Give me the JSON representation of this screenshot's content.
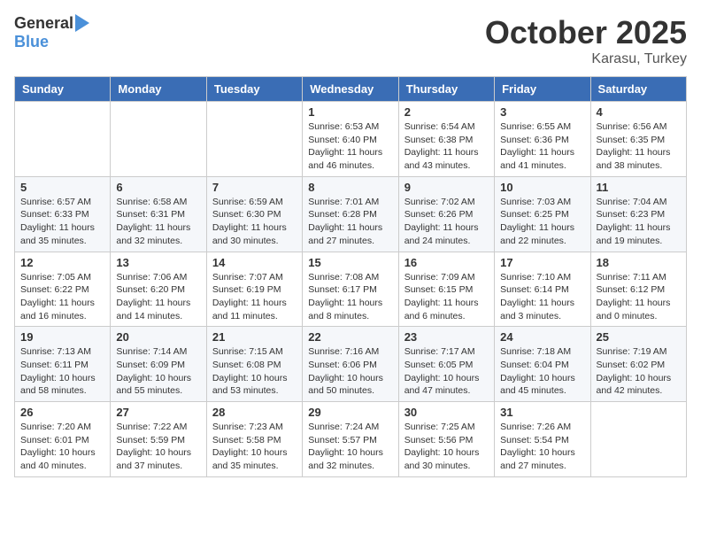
{
  "header": {
    "logo": {
      "general": "General",
      "blue": "Blue"
    },
    "title": "October 2025",
    "subtitle": "Karasu, Turkey"
  },
  "weekdays": [
    "Sunday",
    "Monday",
    "Tuesday",
    "Wednesday",
    "Thursday",
    "Friday",
    "Saturday"
  ],
  "weeks": [
    [
      null,
      null,
      null,
      {
        "day": "1",
        "sunrise": "6:53 AM",
        "sunset": "6:40 PM",
        "daylight": "11 hours and 46 minutes."
      },
      {
        "day": "2",
        "sunrise": "6:54 AM",
        "sunset": "6:38 PM",
        "daylight": "11 hours and 43 minutes."
      },
      {
        "day": "3",
        "sunrise": "6:55 AM",
        "sunset": "6:36 PM",
        "daylight": "11 hours and 41 minutes."
      },
      {
        "day": "4",
        "sunrise": "6:56 AM",
        "sunset": "6:35 PM",
        "daylight": "11 hours and 38 minutes."
      }
    ],
    [
      {
        "day": "5",
        "sunrise": "6:57 AM",
        "sunset": "6:33 PM",
        "daylight": "11 hours and 35 minutes."
      },
      {
        "day": "6",
        "sunrise": "6:58 AM",
        "sunset": "6:31 PM",
        "daylight": "11 hours and 32 minutes."
      },
      {
        "day": "7",
        "sunrise": "6:59 AM",
        "sunset": "6:30 PM",
        "daylight": "11 hours and 30 minutes."
      },
      {
        "day": "8",
        "sunrise": "7:01 AM",
        "sunset": "6:28 PM",
        "daylight": "11 hours and 27 minutes."
      },
      {
        "day": "9",
        "sunrise": "7:02 AM",
        "sunset": "6:26 PM",
        "daylight": "11 hours and 24 minutes."
      },
      {
        "day": "10",
        "sunrise": "7:03 AM",
        "sunset": "6:25 PM",
        "daylight": "11 hours and 22 minutes."
      },
      {
        "day": "11",
        "sunrise": "7:04 AM",
        "sunset": "6:23 PM",
        "daylight": "11 hours and 19 minutes."
      }
    ],
    [
      {
        "day": "12",
        "sunrise": "7:05 AM",
        "sunset": "6:22 PM",
        "daylight": "11 hours and 16 minutes."
      },
      {
        "day": "13",
        "sunrise": "7:06 AM",
        "sunset": "6:20 PM",
        "daylight": "11 hours and 14 minutes."
      },
      {
        "day": "14",
        "sunrise": "7:07 AM",
        "sunset": "6:19 PM",
        "daylight": "11 hours and 11 minutes."
      },
      {
        "day": "15",
        "sunrise": "7:08 AM",
        "sunset": "6:17 PM",
        "daylight": "11 hours and 8 minutes."
      },
      {
        "day": "16",
        "sunrise": "7:09 AM",
        "sunset": "6:15 PM",
        "daylight": "11 hours and 6 minutes."
      },
      {
        "day": "17",
        "sunrise": "7:10 AM",
        "sunset": "6:14 PM",
        "daylight": "11 hours and 3 minutes."
      },
      {
        "day": "18",
        "sunrise": "7:11 AM",
        "sunset": "6:12 PM",
        "daylight": "11 hours and 0 minutes."
      }
    ],
    [
      {
        "day": "19",
        "sunrise": "7:13 AM",
        "sunset": "6:11 PM",
        "daylight": "10 hours and 58 minutes."
      },
      {
        "day": "20",
        "sunrise": "7:14 AM",
        "sunset": "6:09 PM",
        "daylight": "10 hours and 55 minutes."
      },
      {
        "day": "21",
        "sunrise": "7:15 AM",
        "sunset": "6:08 PM",
        "daylight": "10 hours and 53 minutes."
      },
      {
        "day": "22",
        "sunrise": "7:16 AM",
        "sunset": "6:06 PM",
        "daylight": "10 hours and 50 minutes."
      },
      {
        "day": "23",
        "sunrise": "7:17 AM",
        "sunset": "6:05 PM",
        "daylight": "10 hours and 47 minutes."
      },
      {
        "day": "24",
        "sunrise": "7:18 AM",
        "sunset": "6:04 PM",
        "daylight": "10 hours and 45 minutes."
      },
      {
        "day": "25",
        "sunrise": "7:19 AM",
        "sunset": "6:02 PM",
        "daylight": "10 hours and 42 minutes."
      }
    ],
    [
      {
        "day": "26",
        "sunrise": "7:20 AM",
        "sunset": "6:01 PM",
        "daylight": "10 hours and 40 minutes."
      },
      {
        "day": "27",
        "sunrise": "7:22 AM",
        "sunset": "5:59 PM",
        "daylight": "10 hours and 37 minutes."
      },
      {
        "day": "28",
        "sunrise": "7:23 AM",
        "sunset": "5:58 PM",
        "daylight": "10 hours and 35 minutes."
      },
      {
        "day": "29",
        "sunrise": "7:24 AM",
        "sunset": "5:57 PM",
        "daylight": "10 hours and 32 minutes."
      },
      {
        "day": "30",
        "sunrise": "7:25 AM",
        "sunset": "5:56 PM",
        "daylight": "10 hours and 30 minutes."
      },
      {
        "day": "31",
        "sunrise": "7:26 AM",
        "sunset": "5:54 PM",
        "daylight": "10 hours and 27 minutes."
      },
      null
    ]
  ]
}
